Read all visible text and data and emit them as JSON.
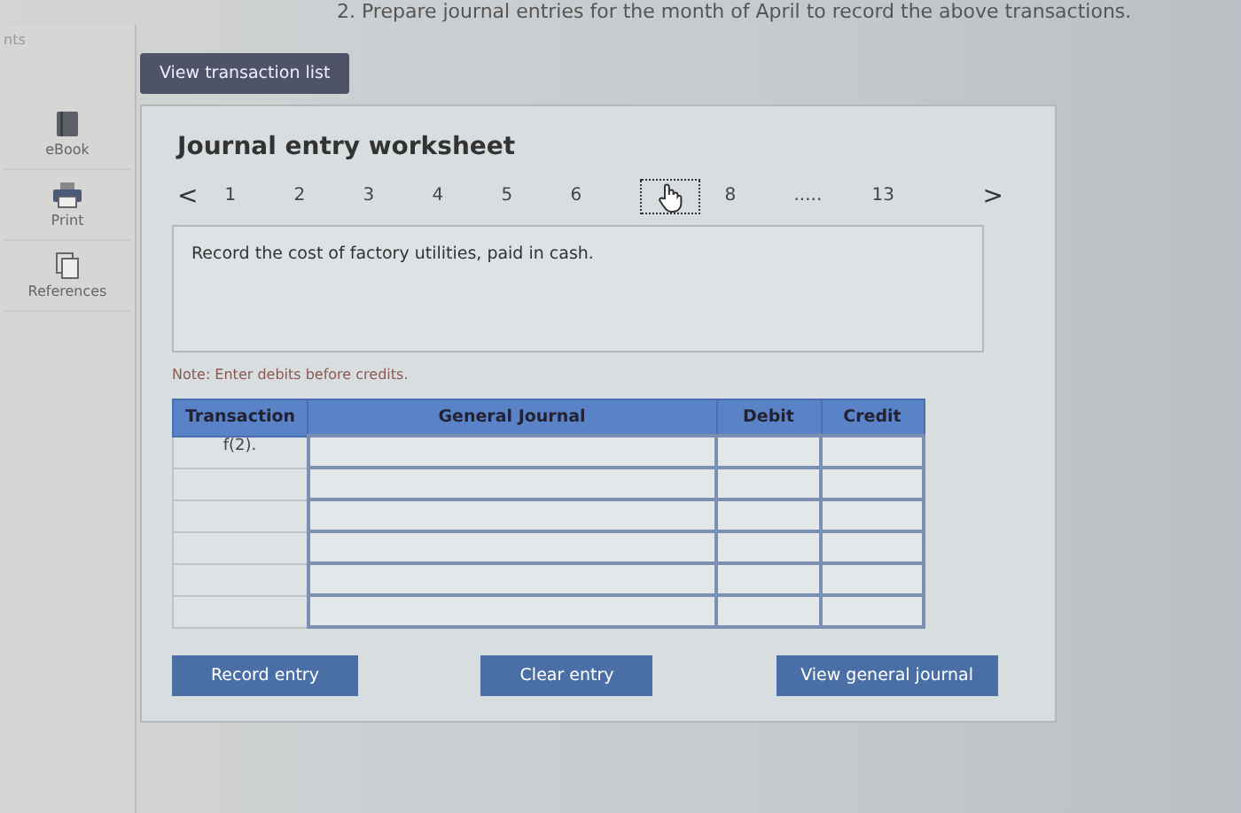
{
  "instruction": "2. Prepare journal entries for the month of April to record the above transactions.",
  "hint_label": "nts",
  "view_button": "View transaction list",
  "sidebar": {
    "items": [
      {
        "label": "eBook",
        "kind": "book"
      },
      {
        "label": "Print",
        "kind": "printer"
      },
      {
        "label": "References",
        "kind": "pages"
      }
    ]
  },
  "worksheet": {
    "title": "Journal entry worksheet",
    "prev": "<",
    "next": ">",
    "pages": [
      {
        "label": "1",
        "selected": false
      },
      {
        "label": "2",
        "selected": false
      },
      {
        "label": "3",
        "selected": false
      },
      {
        "label": "4",
        "selected": false
      },
      {
        "label": "5",
        "selected": false
      },
      {
        "label": "6",
        "selected": false
      },
      {
        "selected": true
      },
      {
        "label": "8",
        "selected": false
      },
      {
        "label": ".....",
        "selected": false
      },
      {
        "label": "13",
        "selected": false
      }
    ],
    "description": "Record the cost of factory utilities, paid in cash.",
    "note": "Note: Enter debits before credits.",
    "table": {
      "columns": [
        "Transaction",
        "General Journal",
        "Debit",
        "Credit"
      ],
      "rows": [
        {
          "transaction": "f(2)."
        },
        {},
        {},
        {},
        {},
        {}
      ]
    },
    "buttons": [
      "Record entry",
      "Clear entry",
      "View general journal"
    ]
  }
}
